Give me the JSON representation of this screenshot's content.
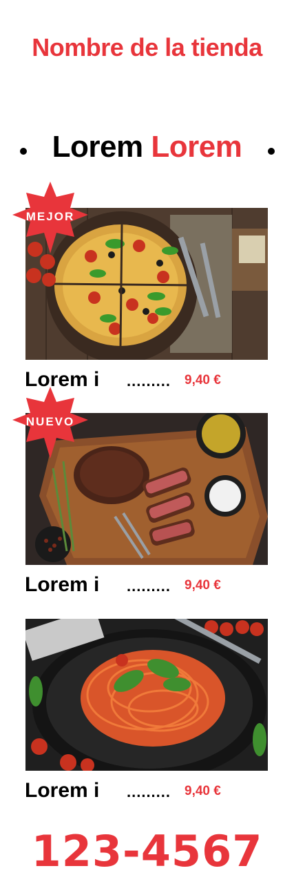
{
  "store_name": "Nombre de la tienda",
  "heading": {
    "part1": "Lorem",
    "part2": "Lorem"
  },
  "items": [
    {
      "name": "Lorem i",
      "leader": ".........",
      "price": "9,40 €",
      "badge": "MEJOR",
      "image": "pizza-photo"
    },
    {
      "name": "Lorem i",
      "leader": ".........",
      "price": "9,40 €",
      "badge": "NUEVO",
      "image": "steak-photo"
    },
    {
      "name": "Lorem i",
      "leader": ".........",
      "price": "9,40 €",
      "badge": "",
      "image": "spaghetti-photo"
    }
  ],
  "phone": "123-4567",
  "colors": {
    "accent": "#e8353b",
    "text": "#000000",
    "background": "#ffffff"
  }
}
